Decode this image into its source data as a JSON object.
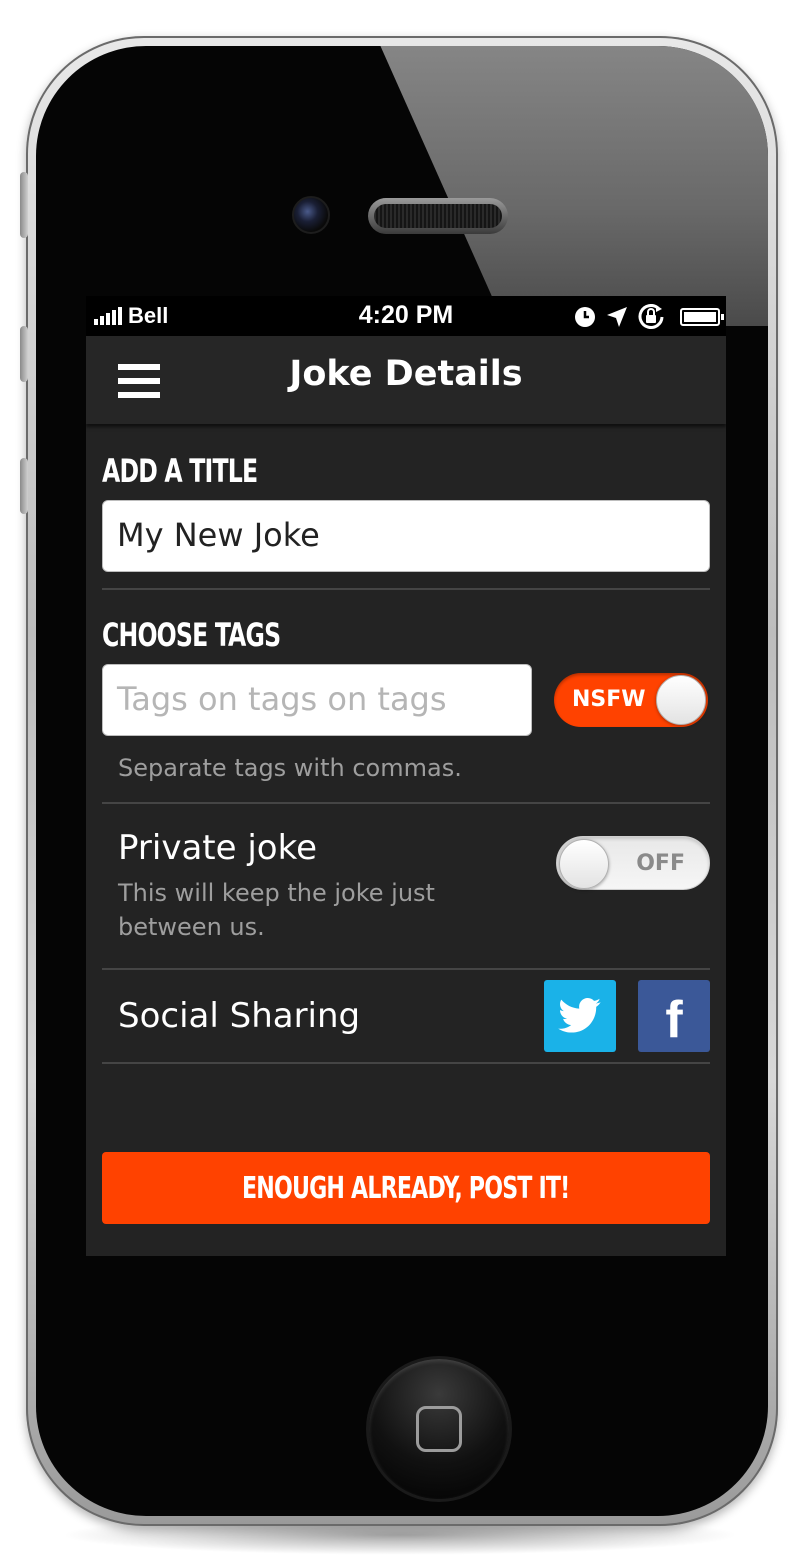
{
  "status_bar": {
    "carrier": "Bell",
    "time": "4:20 PM",
    "icons": [
      "signal-icon",
      "clock-icon",
      "location-arrow-icon",
      "rotation-lock-icon",
      "battery-icon"
    ]
  },
  "nav": {
    "title": "Joke Details",
    "menu_icon": "hamburger-menu-icon"
  },
  "title_section": {
    "heading": "ADD A TITLE",
    "input_value": "My New Joke"
  },
  "tags_section": {
    "heading": "CHOOSE TAGS",
    "input_placeholder": "Tags on tags on tags",
    "hint": "Separate tags with commas.",
    "nsfw_toggle": {
      "label": "NSFW",
      "on": true
    }
  },
  "private_section": {
    "label": "Private joke",
    "description": "This will keep the joke just between us.",
    "toggle": {
      "label": "OFF",
      "on": false
    }
  },
  "social_section": {
    "label": "Social Sharing",
    "buttons": [
      {
        "name": "twitter",
        "icon": "twitter-bird-icon",
        "color": "#1ab2e8"
      },
      {
        "name": "facebook",
        "icon": "facebook-f-icon",
        "glyph": "f",
        "color": "#3b5898"
      }
    ]
  },
  "post_button": {
    "label": "ENOUGH ALREADY, POST IT!",
    "color": "#ff4200"
  },
  "colors": {
    "background": "#232323",
    "accent": "#ff4200",
    "divider": "#454545"
  }
}
